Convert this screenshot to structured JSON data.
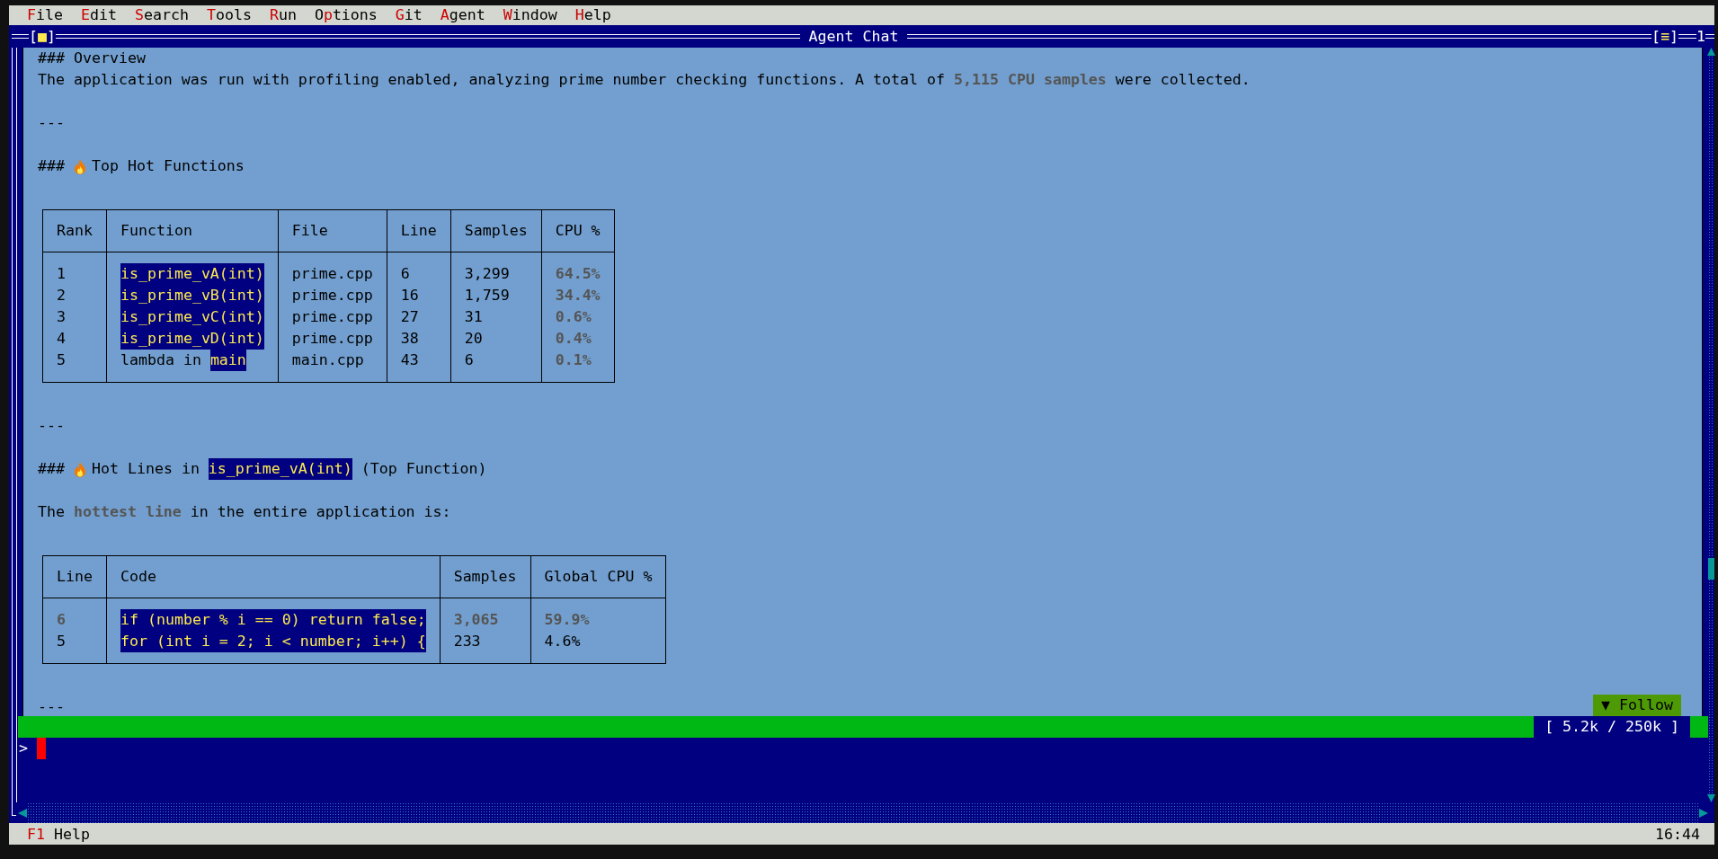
{
  "menu": [
    {
      "hotkey": "F",
      "rest": "ile"
    },
    {
      "hotkey": "E",
      "rest": "dit"
    },
    {
      "hotkey": "S",
      "rest": "earch"
    },
    {
      "hotkey": "T",
      "rest": "ools"
    },
    {
      "hotkey": "R",
      "rest": "un"
    },
    {
      "lead": "O",
      "hotkey": "p",
      "rest": "tions"
    },
    {
      "hotkey": "G",
      "rest": "it"
    },
    {
      "hotkey": "A",
      "rest": "gent"
    },
    {
      "hotkey": "W",
      "rest": "indow"
    },
    {
      "hotkey": "H",
      "rest": "elp"
    }
  ],
  "window": {
    "title": "Agent Chat",
    "close_button": "[■]",
    "menu_button": "[≡]",
    "number": "1"
  },
  "chat": {
    "blocks": [
      {
        "kind": "heading",
        "prefix": "###",
        "parts": [
          {
            "text": "Overview",
            "kind": "plain"
          }
        ]
      },
      {
        "kind": "paragraph",
        "text": "The application was run with profiling enabled, analyzing prime number checking functions. A total of **5,115 CPU samples** were collected."
      },
      {
        "kind": "blank"
      },
      {
        "kind": "rule",
        "text": "---"
      },
      {
        "kind": "blank"
      },
      {
        "kind": "emoji_heading",
        "prefix": "###",
        "parts": [
          {
            "text": "Top Hot Functions",
            "kind": "plain"
          }
        ]
      },
      {
        "kind": "blank"
      },
      {
        "kind": "table",
        "columns": [
          "Rank",
          "Function",
          "File",
          "Line",
          "Samples",
          "CPU %"
        ],
        "rows": [
          [
            {
              "text": "1",
              "kind": "plain"
            },
            {
              "text": "is_prime_vA(int)",
              "kind": "code"
            },
            {
              "text": "prime.cpp",
              "kind": "plain"
            },
            {
              "text": "6",
              "kind": "plain"
            },
            {
              "text": "3,299",
              "kind": "plain"
            },
            {
              "text": "64.5%",
              "kind": "strong"
            }
          ],
          [
            {
              "text": "2",
              "kind": "plain"
            },
            {
              "text": "is_prime_vB(int)",
              "kind": "code"
            },
            {
              "text": "prime.cpp",
              "kind": "plain"
            },
            {
              "text": "16",
              "kind": "plain"
            },
            {
              "text": "1,759",
              "kind": "plain"
            },
            {
              "text": "34.4%",
              "kind": "strong"
            }
          ],
          [
            {
              "text": "3",
              "kind": "plain"
            },
            {
              "text": "is_prime_vC(int)",
              "kind": "code"
            },
            {
              "text": "prime.cpp",
              "kind": "plain"
            },
            {
              "text": "27",
              "kind": "plain"
            },
            {
              "text": "31",
              "kind": "plain"
            },
            {
              "text": "0.6%",
              "kind": "strong"
            }
          ],
          [
            {
              "text": "4",
              "kind": "plain"
            },
            {
              "text": "is_prime_vD(int)",
              "kind": "code"
            },
            {
              "text": "prime.cpp",
              "kind": "plain"
            },
            {
              "text": "38",
              "kind": "plain"
            },
            {
              "text": "20",
              "kind": "plain"
            },
            {
              "text": "0.4%",
              "kind": "strong"
            }
          ],
          [
            {
              "text": "5",
              "kind": "plain"
            },
            {
              "parts": [
                {
                  "text": "lambda in ",
                  "kind": "plain"
                },
                {
                  "text": "main",
                  "kind": "code"
                }
              ]
            },
            {
              "text": "main.cpp",
              "kind": "plain"
            },
            {
              "text": "43",
              "kind": "plain"
            },
            {
              "text": "6",
              "kind": "plain"
            },
            {
              "text": "0.1%",
              "kind": "strong"
            }
          ]
        ]
      },
      {
        "kind": "blank"
      },
      {
        "kind": "rule",
        "text": "---"
      },
      {
        "kind": "blank"
      },
      {
        "kind": "emoji_heading",
        "prefix": "###",
        "parts": [
          {
            "text": "Hot Lines in ",
            "kind": "plain"
          },
          {
            "text": "is_prime_vA(int)",
            "kind": "code"
          },
          {
            "text": " (Top Function)",
            "kind": "plain"
          }
        ]
      },
      {
        "kind": "blank"
      },
      {
        "kind": "paragraph",
        "text": "The **hottest line** in the entire application is:"
      },
      {
        "kind": "blank"
      },
      {
        "kind": "table",
        "columns": [
          "Line",
          "Code",
          "Samples",
          "Global CPU %"
        ],
        "rows": [
          [
            {
              "text": "6",
              "kind": "strong"
            },
            {
              "text": "if (number % i == 0) return false;",
              "kind": "code"
            },
            {
              "text": "3,065",
              "kind": "strong"
            },
            {
              "text": "59.9%",
              "kind": "strong"
            }
          ],
          [
            {
              "text": "5",
              "kind": "plain"
            },
            {
              "text": "for (int i = 2; i < number; i++) {",
              "kind": "code"
            },
            {
              "text": "233",
              "kind": "plain"
            },
            {
              "text": "4.6%",
              "kind": "plain"
            }
          ]
        ]
      },
      {
        "kind": "blank"
      },
      {
        "kind": "rule",
        "text": "---"
      }
    ]
  },
  "follow_button": "▼ Follow",
  "token_counter": "[ 5.2k / 250k ]",
  "input": {
    "prompt": ">"
  },
  "status_bar": {
    "key": "F1",
    "label": "Help",
    "time": "16:44"
  }
}
